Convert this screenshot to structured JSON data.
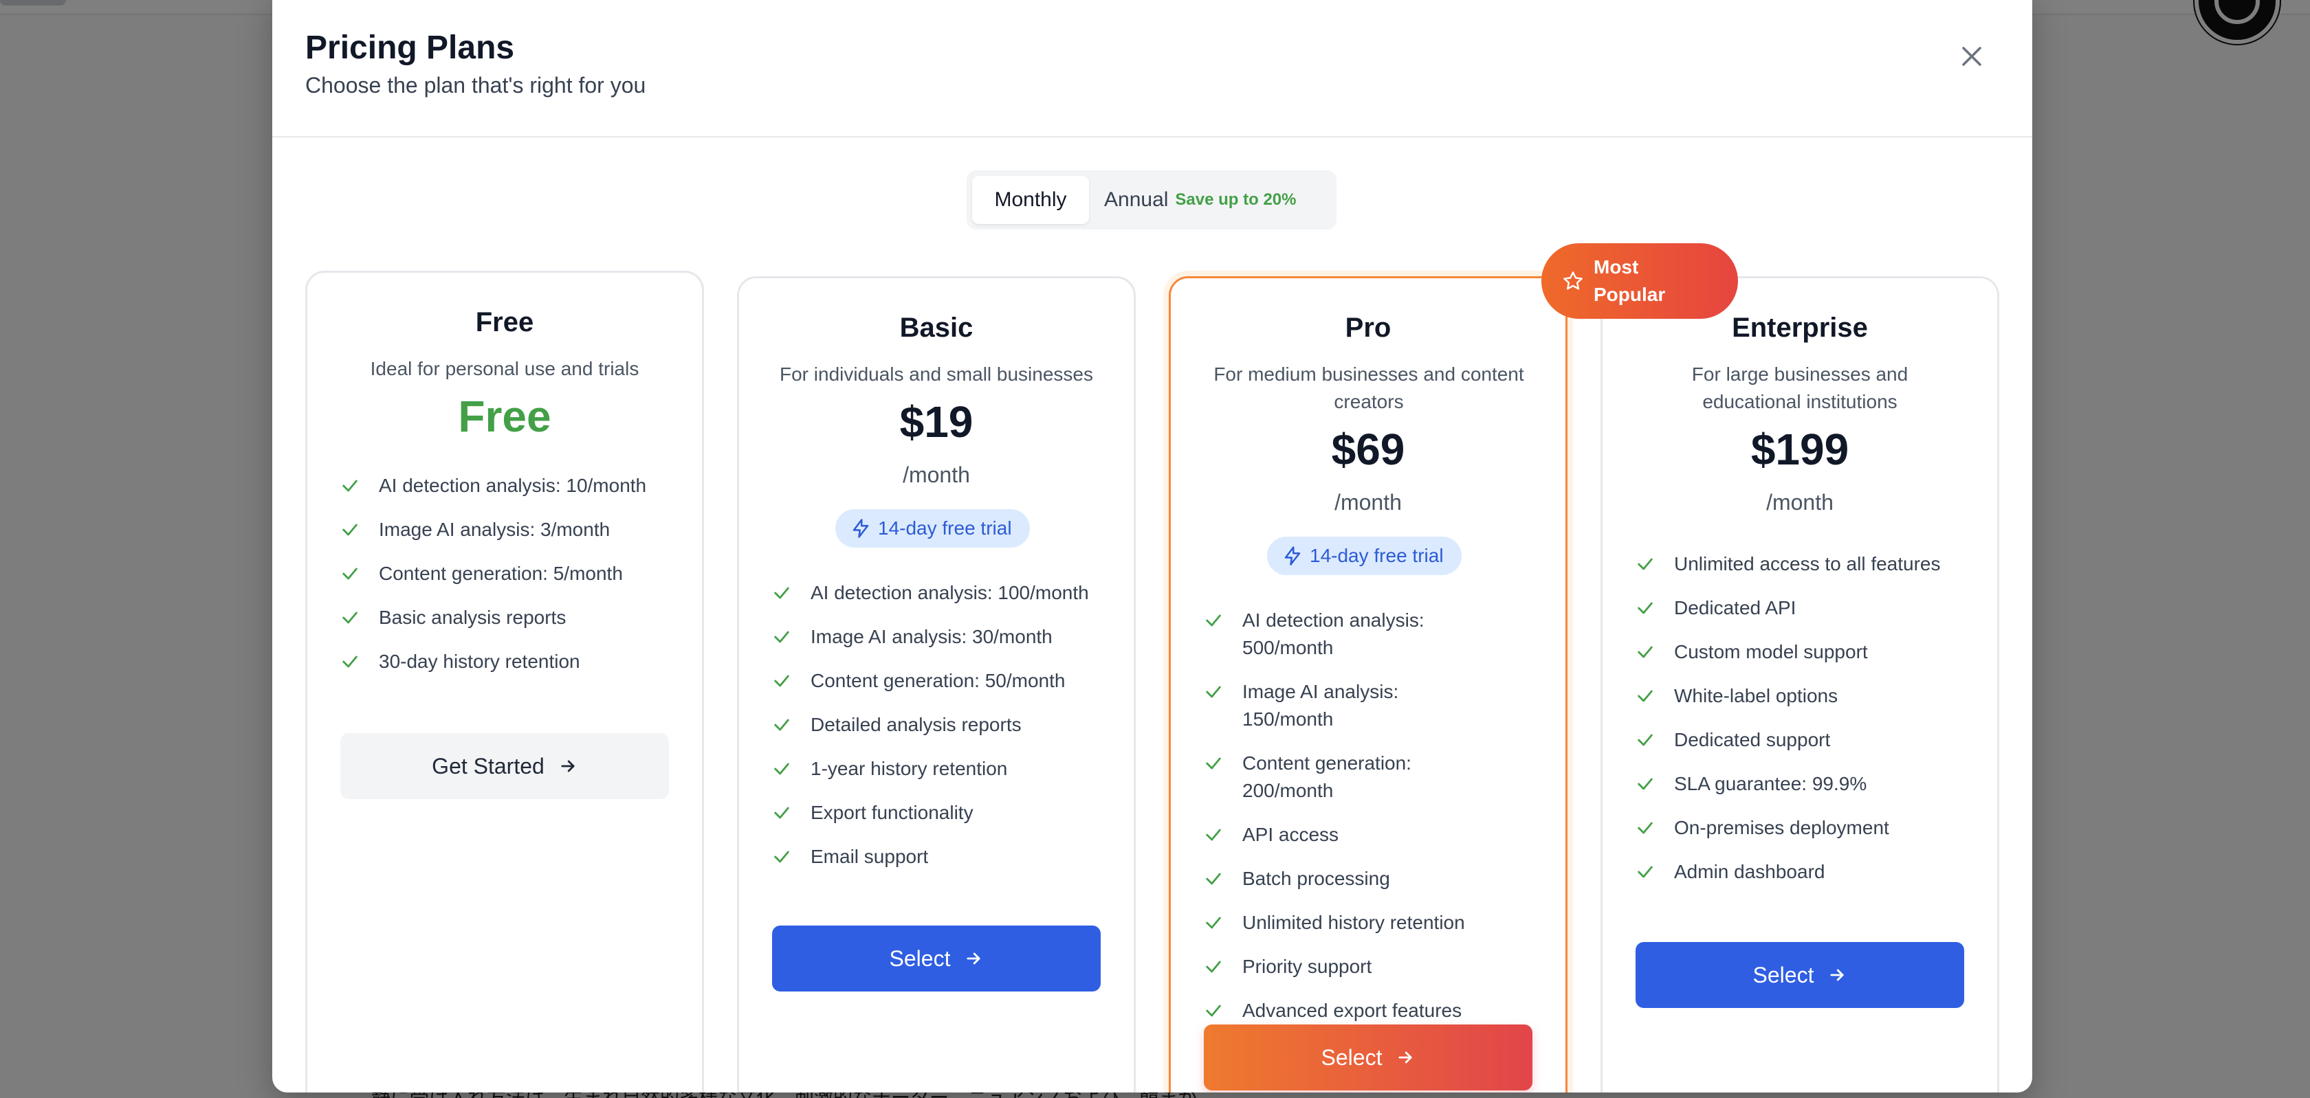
{
  "background": {
    "text_snippet": "静に受け入れ方法は、生まれ自然的多様な文化、刺激的なチーター、ニュアンスおよび、韓まが"
  },
  "modal": {
    "title": "Pricing Plans",
    "subtitle": "Choose the plan that's right for you",
    "close_icon": "close-icon"
  },
  "billing_toggle": {
    "monthly_label": "Monthly",
    "annual_label": "Annual",
    "annual_badge": "Save up to 20%",
    "selected": "Monthly"
  },
  "popular_badge": {
    "label": "Most Popular",
    "icon": "star-icon"
  },
  "plans": [
    {
      "name": "Free",
      "description": "Ideal for personal use and trials",
      "price": "Free",
      "features": [
        "AI detection analysis: 10/month",
        "Image AI analysis: 3/month",
        "Content generation: 5/month",
        "Basic analysis reports",
        "30-day history retention"
      ],
      "button_label": "Get Started"
    },
    {
      "name": "Basic",
      "description": "For individuals and small businesses",
      "price": "$19",
      "period": "/month",
      "trial": "14-day free trial",
      "features": [
        "AI detection analysis: 100/month",
        "Image AI analysis: 30/month",
        "Content generation: 50/month",
        "Detailed analysis reports",
        "1-year history retention",
        "Export functionality",
        "Email support"
      ],
      "button_label": "Select"
    },
    {
      "name": "Pro",
      "description": "For medium businesses and content creators",
      "price": "$69",
      "period": "/month",
      "trial": "14-day free trial",
      "features": [
        "AI detection analysis: 500/month",
        "Image AI analysis: 150/month",
        "Content generation: 200/month",
        "API access",
        "Batch processing",
        "Unlimited history retention",
        "Priority support",
        "Advanced export features"
      ],
      "button_label": "Select"
    },
    {
      "name": "Enterprise",
      "description": "For large businesses and educational institutions",
      "price": "$199",
      "period": "/month",
      "features": [
        "Unlimited access to all features",
        "Dedicated API",
        "Custom model support",
        "White-label options",
        "Dedicated support",
        "SLA guarantee: 99.9%",
        "On-premises deployment",
        "Admin dashboard"
      ],
      "button_label": "Select"
    }
  ],
  "colors": {
    "accent_green": "#43a047",
    "primary_blue": "#2f5ee2",
    "popular_orange": "#ef7a2e",
    "popular_red": "#e2454a",
    "trial_bg": "#dbeafe"
  }
}
